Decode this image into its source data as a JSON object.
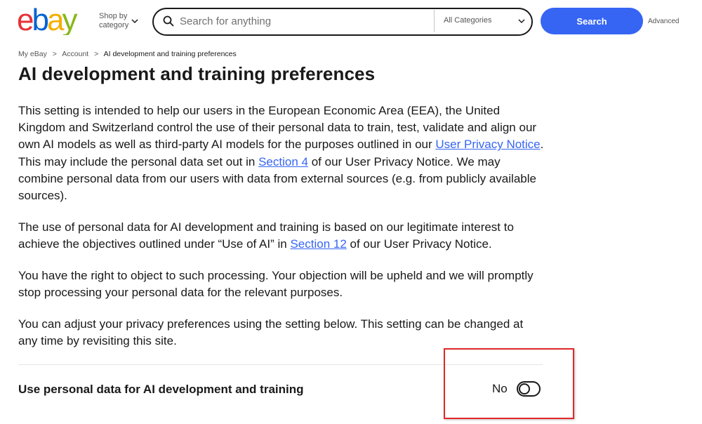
{
  "header": {
    "logo_text": "ebay",
    "shop_by_line1": "Shop by",
    "shop_by_line2": "category",
    "search_placeholder": "Search for anything",
    "category_label": "All Categories",
    "search_button": "Search",
    "advanced_link": "Advanced"
  },
  "breadcrumb": {
    "items": [
      "My eBay",
      "Account",
      "AI development and training preferences"
    ],
    "separator": ">"
  },
  "page": {
    "title": "AI development and training preferences",
    "p1_a": "This setting is intended to help our users in the European Economic Area (EEA), the United Kingdom and Switzerland control the use of their personal data to train, test, validate and align our own AI models as well as third-party AI models for the purposes outlined in our ",
    "p1_link1": "User Privacy Notice",
    "p1_b": ". This may include the personal data set out in ",
    "p1_link2": "Section 4",
    "p1_c": " of our User Privacy Notice. We may combine personal data from our users with data from external sources (e.g. from publicly available sources).",
    "p2_a": "The use of personal data for AI development and training is based on our legitimate interest to achieve the objectives outlined under “Use of AI” in ",
    "p2_link": "Section 12",
    "p2_b": " of our User Privacy Notice.",
    "p3": "You have the right to object to such processing. Your objection will be upheld and we will promptly stop processing your personal data for the relevant purposes.",
    "p4": "You can adjust your privacy preferences using the setting below. This setting can be changed at any time by revisiting this site."
  },
  "setting": {
    "label": "Use personal data for AI development and training",
    "state_label": "No",
    "enabled": false
  },
  "colors": {
    "logo_e": "#e53238",
    "logo_b": "#0064d2",
    "logo_a": "#f5af02",
    "logo_y": "#86b817",
    "accent": "#3665f3",
    "highlight_border": "#e02828"
  },
  "icons": [
    "search-icon",
    "chevron-down-icon",
    "toggle-switch"
  ]
}
